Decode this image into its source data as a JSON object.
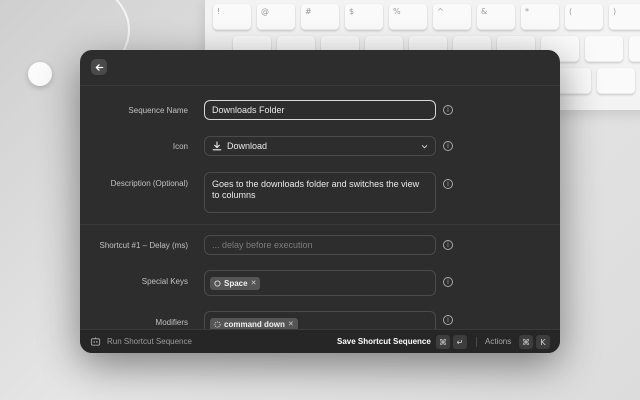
{
  "window": {
    "footer": {
      "run_label": "Run Shortcut Sequence",
      "save_label": "Save Shortcut Sequence",
      "save_keys": [
        "⌘",
        "↵"
      ],
      "actions_label": "Actions",
      "actions_keys": [
        "⌘",
        "K"
      ]
    }
  },
  "form": {
    "sequence_name": {
      "label": "Sequence Name",
      "value": "Downloads Folder"
    },
    "icon": {
      "label": "Icon",
      "value": "Download",
      "icon": "download-icon"
    },
    "description": {
      "label": "Description (Optional)",
      "value": "Goes to the downloads folder and switches the view to columns"
    },
    "delay": {
      "label": "Shortcut #1 – Delay (ms)",
      "placeholder": "... delay before execution"
    },
    "special_keys": {
      "label": "Special Keys",
      "tags": [
        "Space"
      ]
    },
    "modifiers": {
      "label": "Modifiers",
      "tags": [
        "command down"
      ]
    }
  },
  "colors": {
    "window_bg": "#2d2d2d",
    "footer_bg": "#262626",
    "border": "#4a4a4a",
    "accent_text": "#ffffff"
  }
}
